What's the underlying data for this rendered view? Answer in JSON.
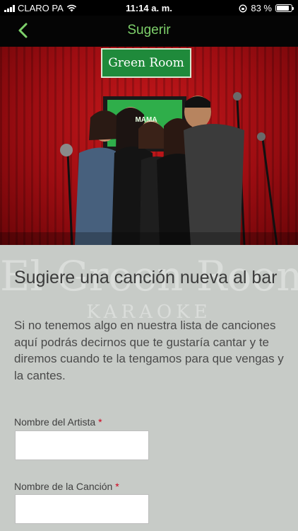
{
  "status_bar": {
    "carrier": "CLARO PA",
    "time": "11:14 a. m.",
    "battery": "83 %",
    "battery_level": 0.83
  },
  "nav": {
    "title": "Sugerir",
    "back_icon": "chevron-left-icon",
    "accent_color": "#7ed16b"
  },
  "hero": {
    "sign_text": "Green Room",
    "screen_text": "MAMA"
  },
  "form": {
    "heading": "Sugiere una canción nueva al bar",
    "description": "Si no tenemos algo en nuestra lista de canciones aquí podrás decirnos que te gustaría cantar y te diremos cuando te la tengamos para que vengas y la cantes.",
    "watermark_line1": "El Green Room",
    "watermark_line2": "KARAOKE",
    "fields": [
      {
        "label": "Nombre del Artista",
        "required_mark": "*",
        "value": ""
      },
      {
        "label": "Nombre de la Canción",
        "required_mark": "*",
        "value": ""
      }
    ]
  }
}
